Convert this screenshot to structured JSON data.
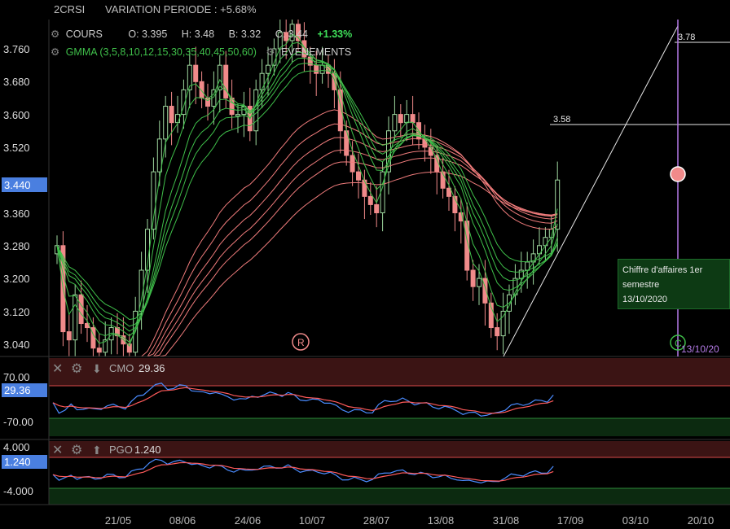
{
  "header": {
    "symbol": "2CRSI",
    "variation": "VARIATION PERIODE : +5.68%"
  },
  "main_legend": {
    "cours_label": "COURS",
    "open": "O: 3.395",
    "high": "H: 3.48",
    "low": "B: 3.32",
    "close": "C: 3.44",
    "change": "+1.33%",
    "gmma_label": "GMMA (3,5,8,10,12,15,30,35,40,45,50,60)",
    "events_label": "EVENEMENTS"
  },
  "price_axis": {
    "ticks": [
      "3.760",
      "3.680",
      "3.600",
      "3.520",
      "3.440",
      "3.360",
      "3.280",
      "3.200",
      "3.120",
      "3.040"
    ],
    "current": "3.440"
  },
  "levels": {
    "upper": "3.78",
    "lower": "3.58"
  },
  "event": {
    "title": "Chiffre d'affaires 1er semestre",
    "date": "13/10/2020",
    "marker_r": "R",
    "marker_c": "C",
    "date_short": "13/10/20"
  },
  "cmo": {
    "label": "CMO",
    "value": "29.36",
    "ticks": [
      "70.00",
      "-70.00"
    ],
    "current": "29.36"
  },
  "pgo": {
    "label": "PGO",
    "value": "1.240",
    "ticks": [
      "4.000",
      "-4.000"
    ],
    "current": "1.240"
  },
  "x_axis": {
    "dates": [
      "21/05",
      "08/06",
      "24/06",
      "10/07",
      "28/07",
      "13/08",
      "31/08",
      "17/09",
      "03/10",
      "20/10"
    ]
  },
  "colors": {
    "up": "#9fd89f",
    "down": "#f08a8a",
    "gmma_short": "#3fbf4a",
    "gmma_long": "#f07c7c",
    "indicator_blue": "#4a8cff",
    "indicator_red": "#ff5a5a",
    "event_line": "#b57be8"
  },
  "chart_data": {
    "type": "candlestick",
    "series": [
      {
        "name": "COURS",
        "close": [
          3.28,
          3.07,
          3.05,
          3.16,
          3.09,
          3.08,
          3.03,
          3.02,
          3.05,
          3.08,
          3.06,
          3.04,
          3.02,
          3.12,
          3.22,
          3.32,
          3.46,
          3.54,
          3.62,
          3.58,
          3.6,
          3.66,
          3.72,
          3.68,
          3.64,
          3.62,
          3.66,
          3.72,
          3.64,
          3.6,
          3.6,
          3.62,
          3.56,
          3.66,
          3.7,
          3.72,
          3.76,
          3.8,
          3.78,
          3.82,
          3.78,
          3.74,
          3.72,
          3.7,
          3.72,
          3.7,
          3.66,
          3.56,
          3.5,
          3.46,
          3.44,
          3.4,
          3.38,
          3.36,
          3.46,
          3.56,
          3.6,
          3.58,
          3.6,
          3.58,
          3.54,
          3.52,
          3.5,
          3.46,
          3.42,
          3.4,
          3.36,
          3.34,
          3.22,
          3.18,
          3.2,
          3.14,
          3.08,
          3.06,
          3.12,
          3.16,
          3.2,
          3.22,
          3.24,
          3.26,
          3.28,
          3.3,
          3.32,
          3.44
        ]
      }
    ],
    "ylim": [
      3.0,
      3.82
    ]
  }
}
